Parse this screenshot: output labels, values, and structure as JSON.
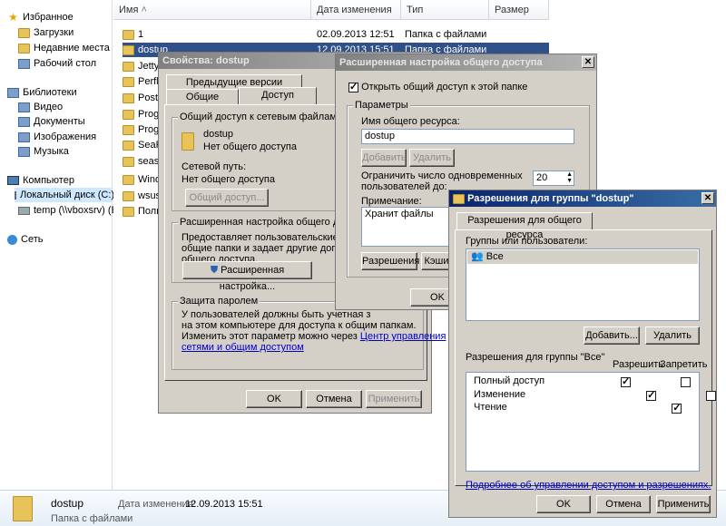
{
  "nav": {
    "favorites": "Избранное",
    "downloads": "Загрузки",
    "recent": "Недавние места",
    "desktop": "Рабочий стол",
    "libraries": "Библиотеки",
    "video": "Видео",
    "documents": "Документы",
    "images": "Изображения",
    "music": "Музыка",
    "computer": "Компьютер",
    "local_disk": "Локальный диск (C:)",
    "temp": "temp (\\\\vboxsrv) (E:)",
    "network": "Сеть"
  },
  "columns": {
    "name": "Имя",
    "date": "Дата изменения",
    "type": "Тип",
    "size": "Размер"
  },
  "files": [
    {
      "name": "1",
      "date": "02.09.2013 12:51",
      "type": "Папка с файлами"
    },
    {
      "name": "dostup",
      "date": "12.09.2013 15:51",
      "type": "Папка с файлами"
    },
    {
      "name": "Jetty"
    },
    {
      "name": "Perfl"
    },
    {
      "name": "Posts"
    },
    {
      "name": "Prog"
    },
    {
      "name": "Prog"
    },
    {
      "name": "SeaF"
    },
    {
      "name": "seas"
    },
    {
      "name": "Wind"
    },
    {
      "name": "wsus"
    },
    {
      "name": "Поль"
    }
  ],
  "status": {
    "name": "dostup",
    "date_label": "Дата изменения:",
    "date": "12.09.2013 15:51",
    "type": "Папка с файлами"
  },
  "props": {
    "title": "Свойства: dostup",
    "tab_prev": "Предыдущие версии",
    "tab_general": "Общие",
    "tab_access": "Доступ",
    "group1": "Общий доступ к сетевым файлам и папка",
    "folder_name": "dostup",
    "folder_status": "Нет общего доступа",
    "net_path_label": "Сетевой путь:",
    "net_path_value": "Нет общего доступа",
    "share_btn": "Общий доступ...",
    "group2": "Расширенная настройка общего доступа",
    "adv_text1": "Предоставляет пользовательские разре",
    "adv_text2": "общие папки и задает другие дополнител",
    "adv_text3": "общего доступа.",
    "adv_btn": "Расширенная настройка...",
    "group3": "Защита паролем",
    "pw_text1": "У пользователей должны быть учетная з",
    "pw_text2": "на этом компьютере для доступа к общим папкам.",
    "pw_text3": "Изменить этот параметр можно через ",
    "pw_link1": "Центр управления",
    "pw_link2": "сетями и общим доступом",
    "ok": "OK",
    "cancel": "Отмена",
    "apply": "Применить"
  },
  "adv": {
    "title": "Расширенная настройка общего доступа",
    "open_share": "Открыть общий доступ к этой папке",
    "params": "Параметры",
    "share_name_label": "Имя общего ресурса:",
    "share_name": "dostup",
    "add": "Добавить",
    "remove": "Удалить",
    "limit1": "Ограничить число одновременных",
    "limit2": "пользователей до:",
    "limit_value": "20",
    "note_label": "Примечание:",
    "note": "Хранит файлы",
    "perm_btn": "Разрешения",
    "cache_btn": "Кэши",
    "ok": "OK"
  },
  "perm": {
    "title": "Разрешения для группы \"dostup\"",
    "tab": "Разрешения для общего ресурса",
    "groups_label": "Группы или пользователи:",
    "group_item": "Все",
    "add": "Добавить...",
    "remove": "Удалить",
    "for_group": "Разрешения для группы \"Все\"",
    "allow": "Разрешить",
    "deny": "Запретить",
    "rows": [
      {
        "name": "Полный доступ",
        "allow": true,
        "deny": false
      },
      {
        "name": "Изменение",
        "allow": true,
        "deny": false
      },
      {
        "name": "Чтение",
        "allow": true,
        "deny": false
      }
    ],
    "more_link": "Подробнее об управлении доступом и разрешениях.",
    "ok": "OK",
    "cancel": "Отмена",
    "apply": "Применить"
  }
}
